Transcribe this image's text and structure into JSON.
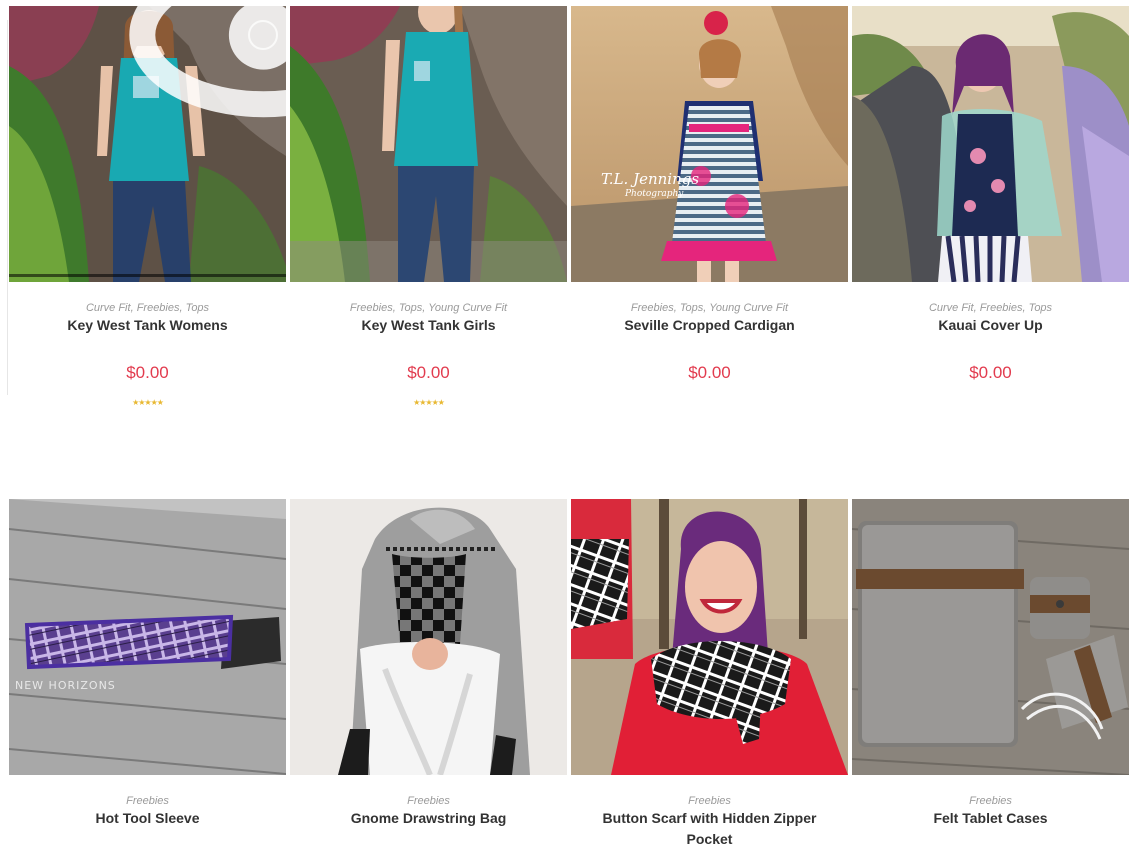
{
  "products": [
    {
      "title": "Key West Tank Womens",
      "categories": [
        "Curve Fit",
        "Freebies",
        "Tops"
      ],
      "price": "$0.00",
      "rating_stars": "★★★★★",
      "image": "woman in teal tank top by rocky wall"
    },
    {
      "title": "Key West Tank Girls",
      "categories": [
        "Freebies",
        "Tops",
        "Young Curve Fit"
      ],
      "price": "$0.00",
      "rating_stars": "★★★★★",
      "image": "girl in teal tank top by rocky wall"
    },
    {
      "title": "Seville Cropped Cardigan",
      "categories": [
        "Freebies",
        "Tops",
        "Young Curve Fit"
      ],
      "price": "$0.00",
      "watermark": [
        "T.L. Jennings",
        "Photography"
      ],
      "image": "little girl in striped dress with navy cardigan"
    },
    {
      "title": "Kauai Cover Up",
      "categories": [
        "Curve Fit",
        "Freebies",
        "Tops"
      ],
      "price": "$0.00",
      "image": "woman in mint kimono cover up on path"
    },
    {
      "title": "Hot Tool Sleeve",
      "categories": [
        "Freebies"
      ],
      "watermark": [
        "NEW HORIZONS"
      ],
      "image": "purple plaid hot tool sleeve on wood"
    },
    {
      "title": "Gnome Drawstring Bag",
      "categories": [
        "Freebies"
      ],
      "image": "gnome shaped drawstring bag"
    },
    {
      "title": "Button Scarf with Hidden Zipper Pocket",
      "title_lines": [
        "Button Scarf with Hidden Zipper",
        "Pocket"
      ],
      "categories": [
        "Freebies"
      ],
      "image": "woman with purple hair in plaid scarf"
    },
    {
      "title": "Felt Tablet Cases",
      "categories": [
        "Freebies"
      ],
      "image": "grey felt tablet case with brown elastic"
    }
  ],
  "icons": {
    "quick_view": "eye-icon"
  },
  "colors": {
    "price": "#e23b4e",
    "stars": "#e8b832",
    "title": "#333333",
    "category": "#9a9a9a"
  }
}
